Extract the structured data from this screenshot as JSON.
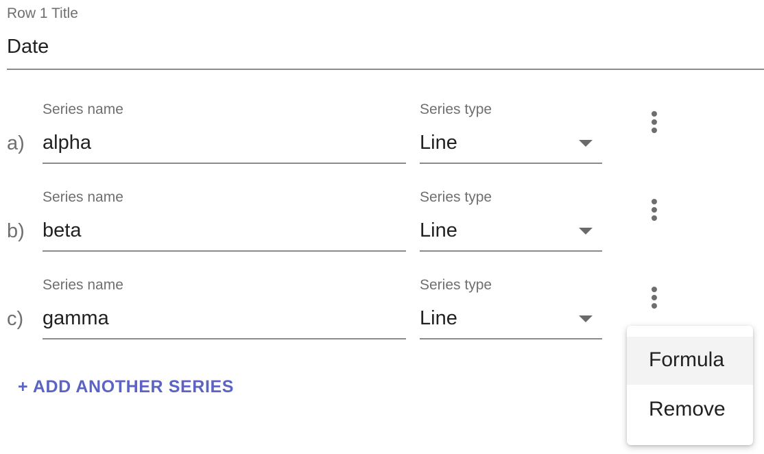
{
  "row_title": {
    "label": "Row 1 Title",
    "value": "Date"
  },
  "series": [
    {
      "letter": "a)",
      "name_label": "Series name",
      "name": "alpha",
      "type_label": "Series type",
      "type": "Line"
    },
    {
      "letter": "b)",
      "name_label": "Series name",
      "name": "beta",
      "type_label": "Series type",
      "type": "Line"
    },
    {
      "letter": "c)",
      "name_label": "Series name",
      "name": "gamma",
      "type_label": "Series type",
      "type": "Line"
    }
  ],
  "add_series_label": "+ ADD ANOTHER SERIES",
  "menu": {
    "items": [
      {
        "label": "Formula",
        "highlighted": true
      },
      {
        "label": "Remove",
        "highlighted": false
      }
    ]
  },
  "colors": {
    "accent": "#5b63c4",
    "label": "#6f6f6f",
    "text": "#212121",
    "underline": "#8a8a8a"
  },
  "icons": [
    "dropdown-caret-icon",
    "more-vert-icon"
  ]
}
